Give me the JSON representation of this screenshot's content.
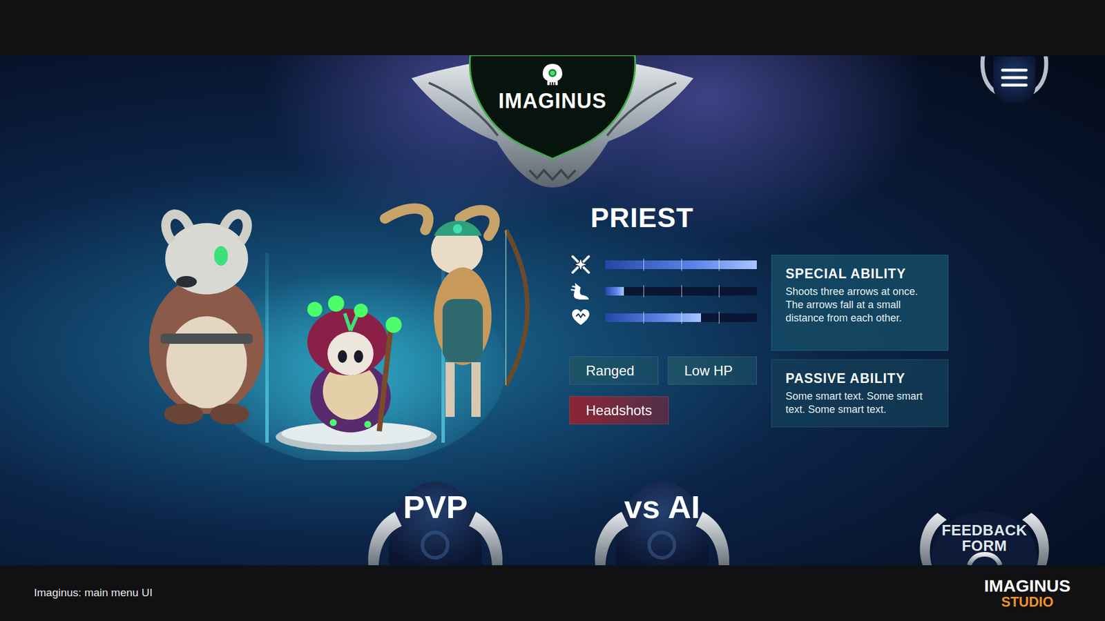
{
  "logo": {
    "title": "IMAGINUS"
  },
  "character": {
    "class": "PRIEST",
    "stats": [
      {
        "kind": "attack",
        "level": 1.0
      },
      {
        "kind": "speed",
        "level": 0.12
      },
      {
        "kind": "health",
        "level": 0.63
      }
    ],
    "tags": [
      {
        "label": "Ranged",
        "color": "#1d5266"
      },
      {
        "label": "Low HP",
        "color": "#1d5266"
      },
      {
        "label": "Headshots",
        "color": "#8c2434"
      }
    ],
    "abilities": [
      {
        "title": "SPECIAL ABILITY",
        "text": "Shoots three arrows at once. The arrows fall at a small distance from each other."
      },
      {
        "title": "PASSIVE ABILITY",
        "text": "Some smart text. Some smart text. Some smart text."
      }
    ]
  },
  "modes": [
    {
      "label": "PVP"
    },
    {
      "label": "vs AI"
    }
  ],
  "feedback": {
    "label": "FEEDBACK FORM"
  },
  "caption": "Imaginus: main menu UI",
  "studio": {
    "name": "IMAGINUS",
    "sub": "STUDIO"
  }
}
